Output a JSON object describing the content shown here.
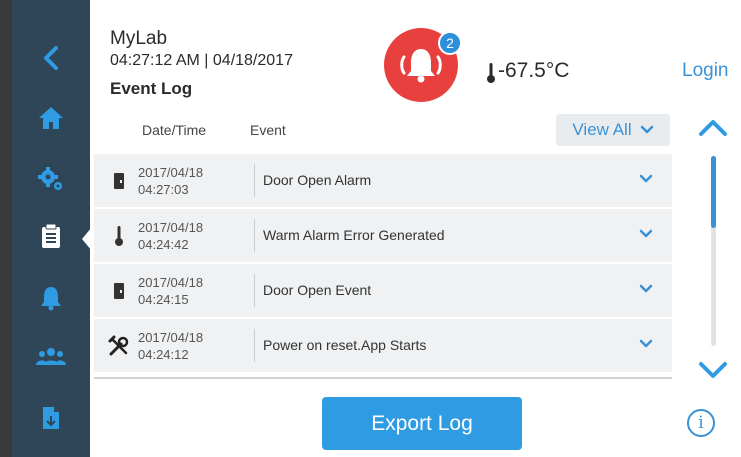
{
  "header": {
    "app_name": "MyLab",
    "datetime": "04:27:12 AM | 04/18/2017",
    "page_title": "Event Log",
    "alarm_count": "2",
    "temperature": "-67.5°C",
    "login_label": "Login"
  },
  "sidebar": {
    "items": [
      {
        "name": "back",
        "icon": "chevron-left-icon"
      },
      {
        "name": "home",
        "icon": "home-icon"
      },
      {
        "name": "settings",
        "icon": "gears-icon"
      },
      {
        "name": "event-log",
        "icon": "clipboard-icon",
        "active": true
      },
      {
        "name": "alarms",
        "icon": "bell-icon"
      },
      {
        "name": "users",
        "icon": "users-icon"
      },
      {
        "name": "export",
        "icon": "file-export-icon"
      }
    ]
  },
  "table": {
    "col_datetime": "Date/Time",
    "col_event": "Event",
    "view_all_label": "View All",
    "rows": [
      {
        "date": "2017/04/18",
        "time": "04:27:03",
        "event": "Door Open Alarm",
        "icon": "door-icon"
      },
      {
        "date": "2017/04/18",
        "time": "04:24:42",
        "event": "Warm Alarm Error Generated",
        "icon": "thermometer-icon"
      },
      {
        "date": "2017/04/18",
        "time": "04:24:15",
        "event": "Door Open Event",
        "icon": "door-icon"
      },
      {
        "date": "2017/04/18",
        "time": "04:24:12",
        "event": "Power on reset.App Starts",
        "icon": "tools-icon"
      }
    ]
  },
  "footer": {
    "export_label": "Export Log",
    "info_label": "i"
  },
  "colors": {
    "sidebar": "#2f4659",
    "accent": "#3a92d6",
    "alarm": "#e8403f",
    "export_button": "#2e9be3"
  }
}
